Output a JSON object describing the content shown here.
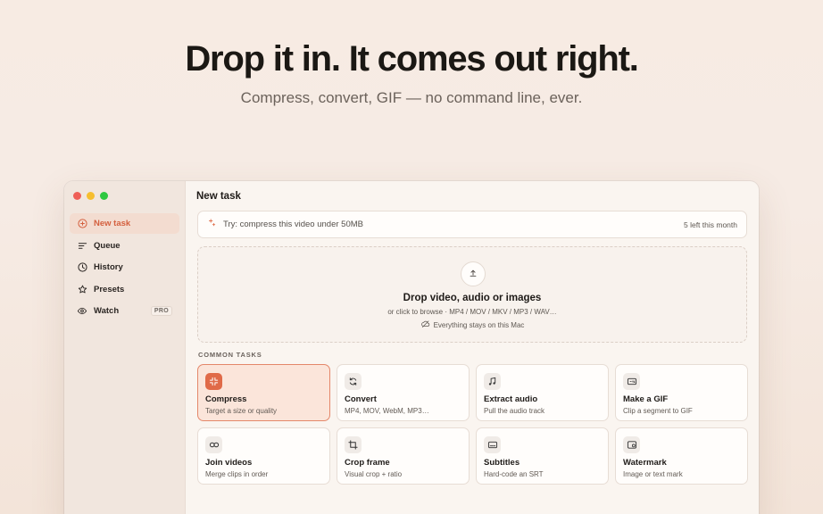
{
  "hero": {
    "title": "Drop it in. It comes out right.",
    "subtitle": "Compress, convert, GIF — no command line, ever."
  },
  "sidebar": {
    "items": [
      {
        "label": "New task",
        "icon": "plus-circle-icon",
        "active": true
      },
      {
        "label": "Queue",
        "icon": "list-icon"
      },
      {
        "label": "History",
        "icon": "clock-icon"
      },
      {
        "label": "Presets",
        "icon": "star-icon"
      },
      {
        "label": "Watch",
        "icon": "eye-icon",
        "badge": "PRO"
      }
    ]
  },
  "main": {
    "title": "New task",
    "prompt": {
      "placeholder": "Try: compress this video under 50MB",
      "quota": "5 left this month"
    },
    "dropzone": {
      "title": "Drop video, audio or images",
      "subtitle": "or click to browse · MP4 / MOV / MKV / MP3 / WAV…",
      "note": "Everything stays on this Mac"
    },
    "section_label": "COMMON TASKS",
    "tasks": [
      {
        "title": "Compress",
        "subtitle": "Target a size or quality",
        "icon": "compress-icon",
        "selected": true
      },
      {
        "title": "Convert",
        "subtitle": "MP4, MOV, WebM, MP3…",
        "icon": "refresh-icon"
      },
      {
        "title": "Extract audio",
        "subtitle": "Pull the audio track",
        "icon": "music-note-icon"
      },
      {
        "title": "Make a GIF",
        "subtitle": "Clip a segment to GIF",
        "icon": "gif-icon"
      },
      {
        "title": "Join videos",
        "subtitle": "Merge clips in order",
        "icon": "link-icon"
      },
      {
        "title": "Crop frame",
        "subtitle": "Visual crop + ratio",
        "icon": "crop-icon"
      },
      {
        "title": "Subtitles",
        "subtitle": "Hard-code an SRT",
        "icon": "subtitles-icon"
      },
      {
        "title": "Watermark",
        "subtitle": "Image or text mark",
        "icon": "watermark-icon"
      }
    ]
  },
  "colors": {
    "accent": "#e06a48",
    "active_bg": "#f3dcd0"
  }
}
